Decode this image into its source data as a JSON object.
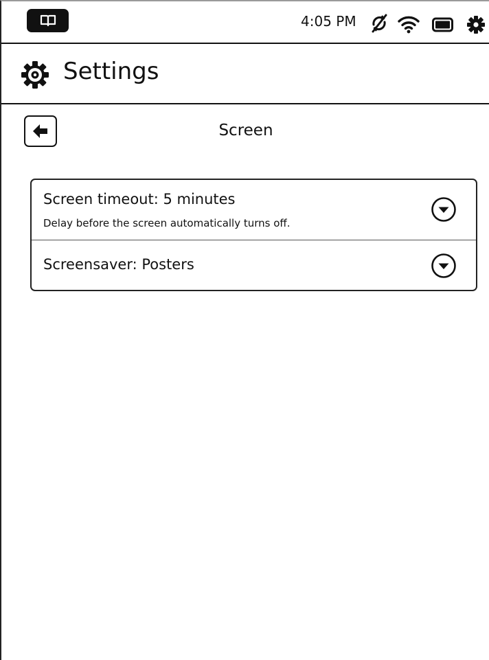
{
  "status_bar": {
    "time": "4:05 PM",
    "icons": [
      "book-icon",
      "sync-disabled-icon",
      "wifi-icon",
      "battery-icon",
      "settings-gear-icon"
    ]
  },
  "header": {
    "title": "Settings",
    "icon": "settings-icon"
  },
  "subheader": {
    "title": "Screen",
    "back_icon": "back-arrow-icon"
  },
  "settings": {
    "items": [
      {
        "label": "Screen timeout: 5 minutes",
        "description": "Delay before the screen automatically turns off.",
        "icon": "chevron-down-circle-icon"
      },
      {
        "label": "Screensaver: Posters",
        "icon": "chevron-down-circle-icon"
      }
    ]
  },
  "colors": {
    "foreground": "#111111",
    "background": "#ffffff"
  }
}
